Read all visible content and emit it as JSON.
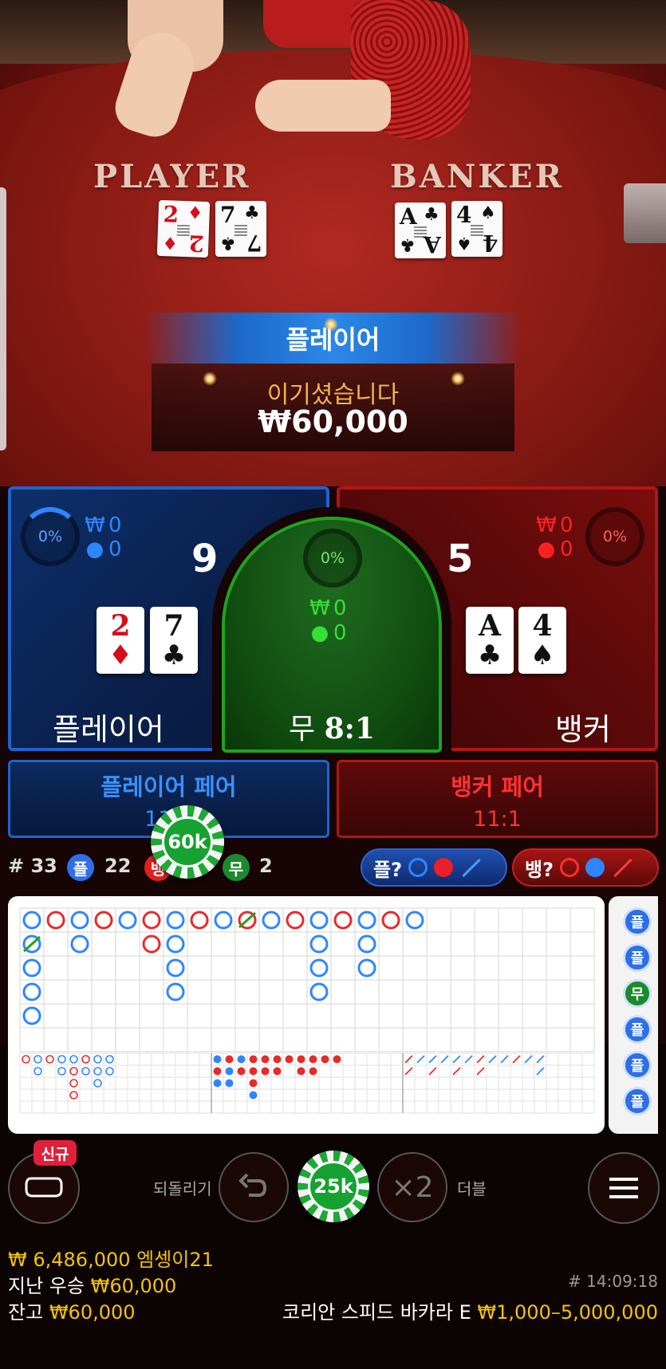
{
  "video": {
    "player_label": "PLAYER",
    "banker_label": "BANKER",
    "player_cards": [
      {
        "rank": "2",
        "suit": "♦",
        "color": "red"
      },
      {
        "rank": "7",
        "suit": "♣",
        "color": "black"
      }
    ],
    "banker_cards": [
      {
        "rank": "A",
        "suit": "♣",
        "color": "black"
      },
      {
        "rank": "4",
        "suit": "♠",
        "color": "black"
      }
    ],
    "result_banner": "플레이어",
    "win_label": "이기셨습니다",
    "win_amount": "₩60,000"
  },
  "board": {
    "player": {
      "percent": "0%",
      "bet": "0",
      "players": "0",
      "score": "9",
      "name": "플레이어",
      "currency_icon": "₩",
      "user_icon": "user-icon",
      "cards": [
        {
          "rank": "2",
          "suit": "♦",
          "color": "red"
        },
        {
          "rank": "7",
          "suit": "♣",
          "color": "black"
        }
      ]
    },
    "banker": {
      "percent": "0%",
      "bet": "0",
      "players": "0",
      "score": "5",
      "name": "뱅커",
      "currency_icon": "₩",
      "user_icon": "user-icon",
      "cards": [
        {
          "rank": "A",
          "suit": "♣",
          "color": "black"
        },
        {
          "rank": "4",
          "suit": "♠",
          "color": "black"
        }
      ]
    },
    "tie": {
      "percent": "0%",
      "bet": "0",
      "players": "0",
      "name": "무",
      "odds": "8:1",
      "currency_icon": "₩"
    },
    "player_pair": {
      "name": "플레이어 페어",
      "odds": "11:1"
    },
    "banker_pair": {
      "name": "뱅커 페어",
      "odds": "11:1"
    },
    "placed_chip": "60k"
  },
  "stats": {
    "round": "# 33",
    "player_glyph": "플",
    "player_count": "22",
    "banker_glyph": "뱅",
    "banker_count": "",
    "tie_glyph": "무",
    "tie_count": "2",
    "player_ask": "플?",
    "banker_ask": "뱅?"
  },
  "roadmap": {
    "big_road_columns": [
      [
        "P",
        "PT",
        "P",
        "P",
        "P"
      ],
      [
        "B"
      ],
      [
        "P",
        "P"
      ],
      [
        "B"
      ],
      [
        "P"
      ],
      [
        "B",
        "B"
      ],
      [
        "P",
        "P",
        "P",
        "P"
      ],
      [
        "B"
      ],
      [
        "P"
      ],
      [
        "BT"
      ],
      [
        "P"
      ],
      [
        "B"
      ],
      [
        "P",
        "P",
        "P",
        "P"
      ],
      [
        "B"
      ],
      [
        "P",
        "P",
        "P"
      ],
      [
        "B"
      ],
      [
        "P"
      ]
    ],
    "side_road": [
      "플",
      "플",
      "무",
      "플",
      "플",
      "플"
    ],
    "side_road_types": [
      "P",
      "P",
      "T",
      "P",
      "P",
      "P"
    ]
  },
  "controls": {
    "new_badge": "신규",
    "undo_label": "되돌리기",
    "selected_chip": "25k",
    "double_symbol": "×2",
    "double_label": "더블"
  },
  "footer": {
    "balance_line": "₩ 6,486,000 엠셍이21",
    "last_win_label": "지난 우승",
    "last_win_amount": "₩60,000",
    "balance_label": "잔고",
    "balance_amount": "₩60,000",
    "game_id": "# 14:09:18",
    "table_name": "코리안 스피드 바카라 E",
    "limits": "₩1,000–5,000,000"
  },
  "colors": {
    "player_blue": "#2e86ff",
    "banker_red": "#e02020",
    "tie_green": "#1fa31f",
    "gold": "#f5c400"
  }
}
